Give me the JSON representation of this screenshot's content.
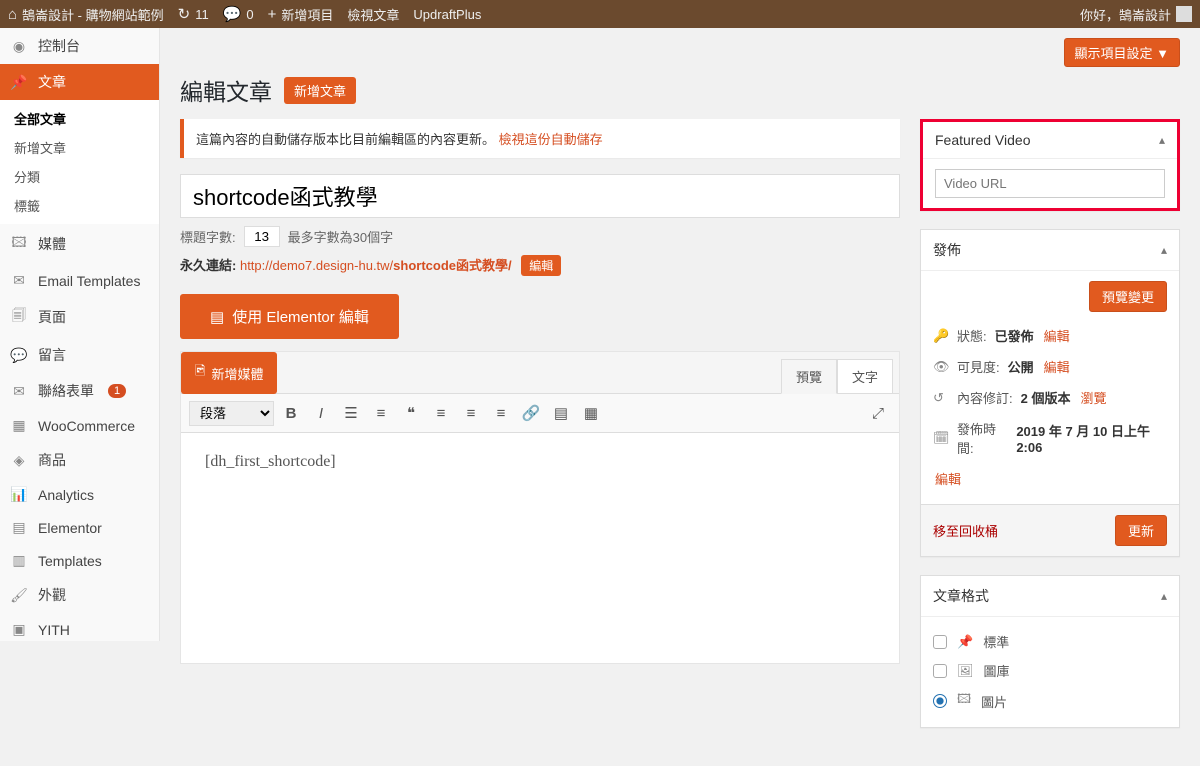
{
  "adminbar": {
    "site_name": "鵠崙設計 - 購物網站範例",
    "updates": "11",
    "comments": "0",
    "new_item": "新增項目",
    "view_post": "檢視文章",
    "updraft": "UpdraftPlus",
    "greeting": "你好，鵠崙設計"
  },
  "sidebar": {
    "dashboard": "控制台",
    "posts": "文章",
    "posts_sub": {
      "all": "全部文章",
      "add": "新增文章",
      "categories": "分類",
      "tags": "標籤"
    },
    "media": "媒體",
    "email_templates": "Email Templates",
    "pages": "頁面",
    "comments_menu": "留言",
    "contact": "聯絡表單",
    "contact_badge": "1",
    "woocommerce": "WooCommerce",
    "products": "商品",
    "analytics": "Analytics",
    "elementor": "Elementor",
    "templates": "Templates",
    "appearance": "外觀",
    "yith": "YITH"
  },
  "screen_options": "顯示項目設定",
  "heading": "編輯文章",
  "add_new": "新增文章",
  "autosave_notice": {
    "text": "這篇內容的自動儲存版本比目前編輯區的內容更新。",
    "link": "檢視這份自動儲存"
  },
  "title_value": "shortcode函式教學",
  "title_count": {
    "label": "標題字數:",
    "value": "13",
    "max_label": "最多字數為30個字"
  },
  "permalink": {
    "label": "永久連結:",
    "base": "http://demo7.design-hu.tw/",
    "slug": "shortcode函式教學/",
    "edit": "編輯"
  },
  "elementor_btn": "使用 Elementor 編輯",
  "editor": {
    "media_btn": "新增媒體",
    "tab_visual": "預覽",
    "tab_text": "文字",
    "format_dropdown": "段落",
    "content": "[dh_first_shortcode]"
  },
  "featured_video": {
    "title": "Featured Video",
    "placeholder": "Video URL"
  },
  "publish": {
    "title": "發佈",
    "preview_btn": "預覽變更",
    "status_label": "狀態:",
    "status_value": "已發佈",
    "status_edit": "編輯",
    "visibility_label": "可見度:",
    "visibility_value": "公開",
    "visibility_edit": "編輯",
    "revisions_label": "內容修訂:",
    "revisions_value": "2 個版本",
    "revisions_browse": "瀏覽",
    "date_label": "發佈時間:",
    "date_value": "2019 年 7 月 10 日上午 2:06",
    "date_edit": "編輯",
    "trash": "移至回收桶",
    "update_btn": "更新"
  },
  "format_box": {
    "title": "文章格式",
    "standard": "標準",
    "gallery": "圖庫",
    "image": "圖片"
  }
}
